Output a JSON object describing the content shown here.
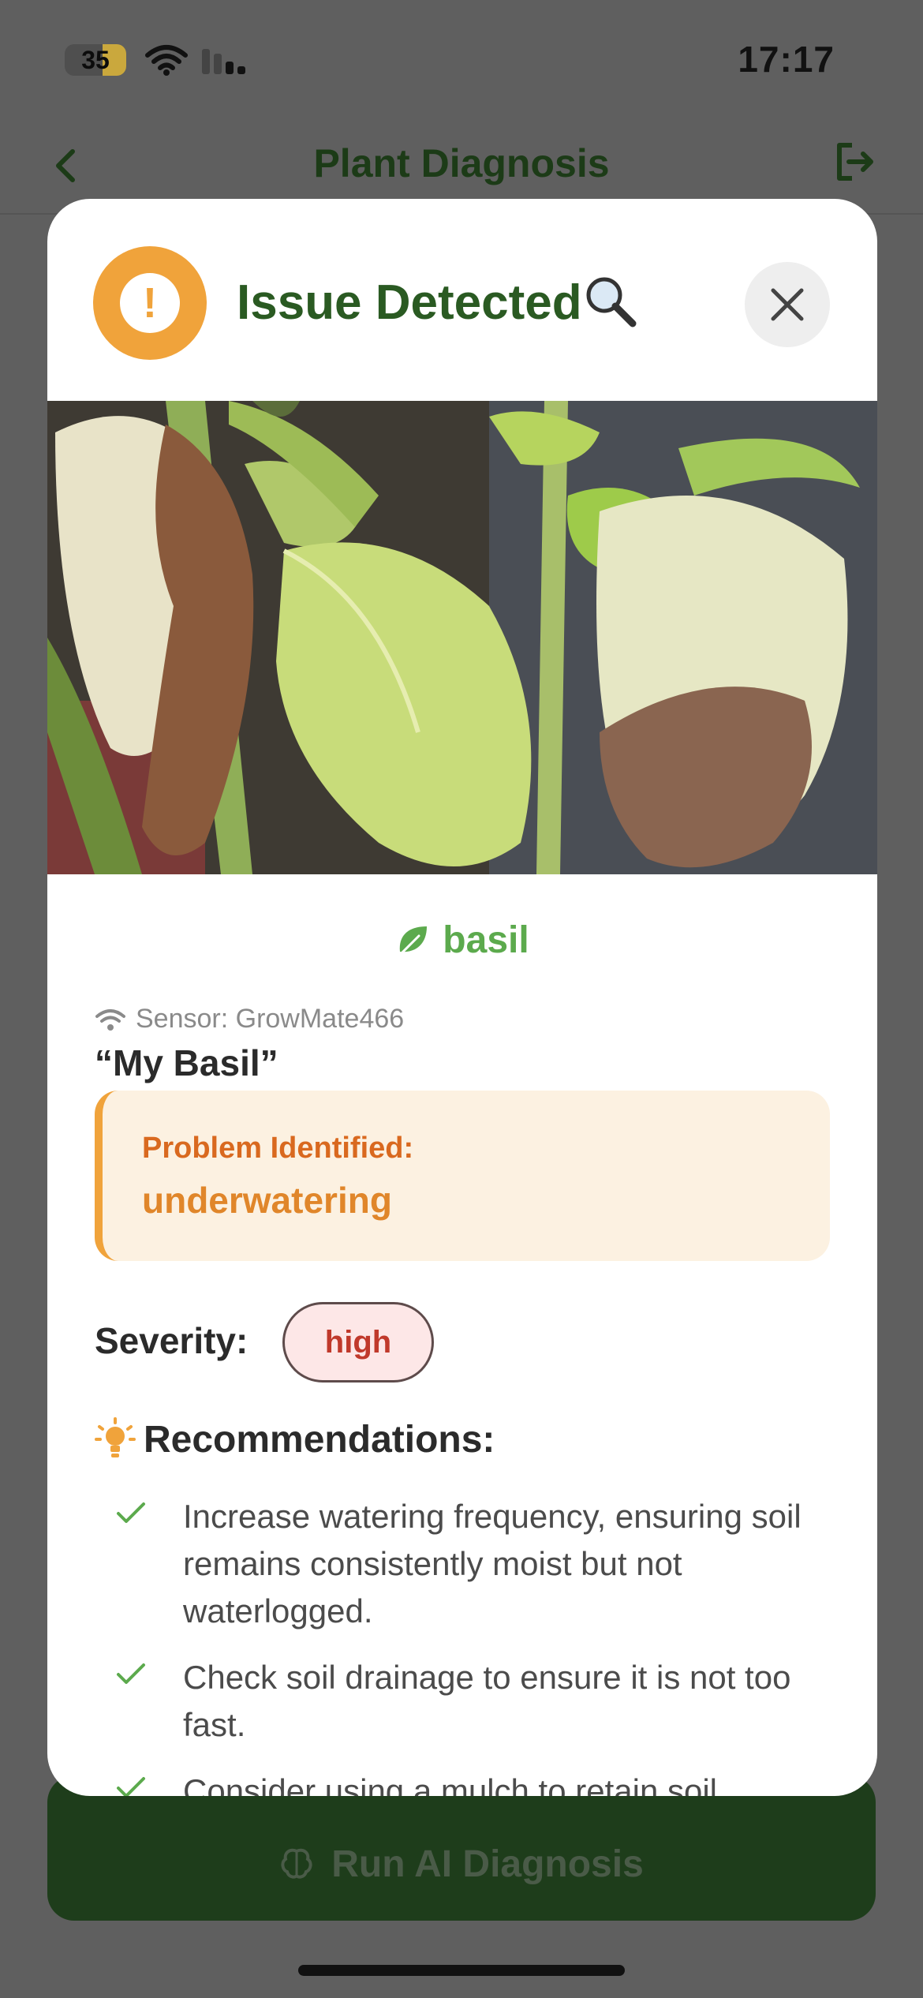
{
  "status_bar": {
    "battery": "35",
    "time": "17:17"
  },
  "nav": {
    "title": "Plant Diagnosis"
  },
  "modal": {
    "title": "Issue Detected",
    "alert_symbol": "!",
    "plant_type": "basil",
    "sensor": "Sensor: GrowMate466",
    "nickname": "“My Basil”",
    "problem": {
      "label": "Problem Identified:",
      "value": "underwatering"
    },
    "severity": {
      "label": "Severity:",
      "value": "high"
    },
    "recommendations_title": "Recommendations:",
    "recommendations": [
      "Increase watering frequency, ensuring soil remains consistently moist but not waterlogged.",
      "Check soil drainage to ensure it is not too fast.",
      "Consider using a mulch to retain soil"
    ]
  },
  "footer": {
    "run_button": "Run AI Diagnosis"
  },
  "colors": {
    "brand_green": "#2a5a22",
    "warning_orange": "#f0a33b",
    "severity_red": "#c0392b",
    "leaf_green": "#5caa4d"
  }
}
